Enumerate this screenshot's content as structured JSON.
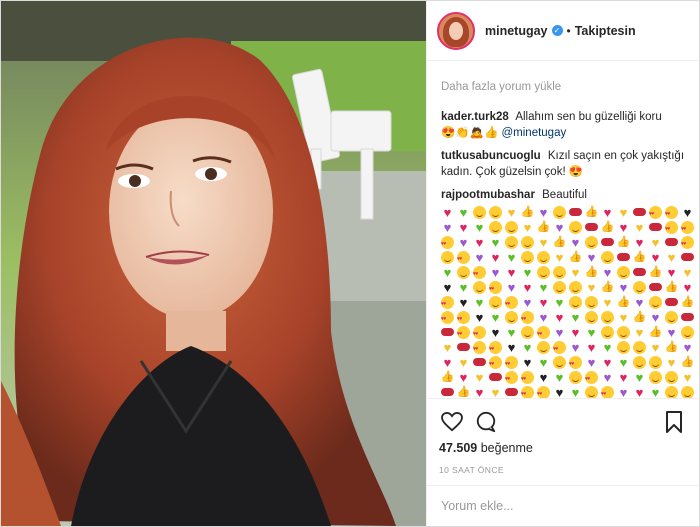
{
  "post": {
    "username": "minetugay",
    "separator": "•",
    "follow_label": "Takiptesin"
  },
  "comments": {
    "load_more": "Daha fazla yorum yükle",
    "items": [
      {
        "user": "kader.turk28",
        "text": "Allahım sen bu güzelliği koru",
        "extra": "😍👏🙇👍",
        "mention": "@minetugay"
      },
      {
        "user": "tutkusabuncuoglu",
        "text": "Kızıl saçın en çok yakıştığı kadın. Çok güzelsin çok! 😍"
      },
      {
        "user": "rajpootmubashar",
        "text": "Beautiful"
      }
    ]
  },
  "emoji_pattern": [
    "heart-red",
    "smile",
    "heart-purple",
    "thumb",
    "kiss",
    "heart-black",
    "love",
    "heart-green",
    "heart-yellow",
    "smile",
    "heart-red",
    "love",
    "heart-green",
    "heart-purple",
    "smile",
    "thumb",
    "kiss",
    "heart-yellow",
    "love",
    "smile"
  ],
  "actions": {
    "likes_count": "47.509",
    "likes_label": "beğenme",
    "time_ago": "10 SAAT ÖNCE"
  },
  "add_comment": {
    "placeholder": "Yorum ekle..."
  }
}
